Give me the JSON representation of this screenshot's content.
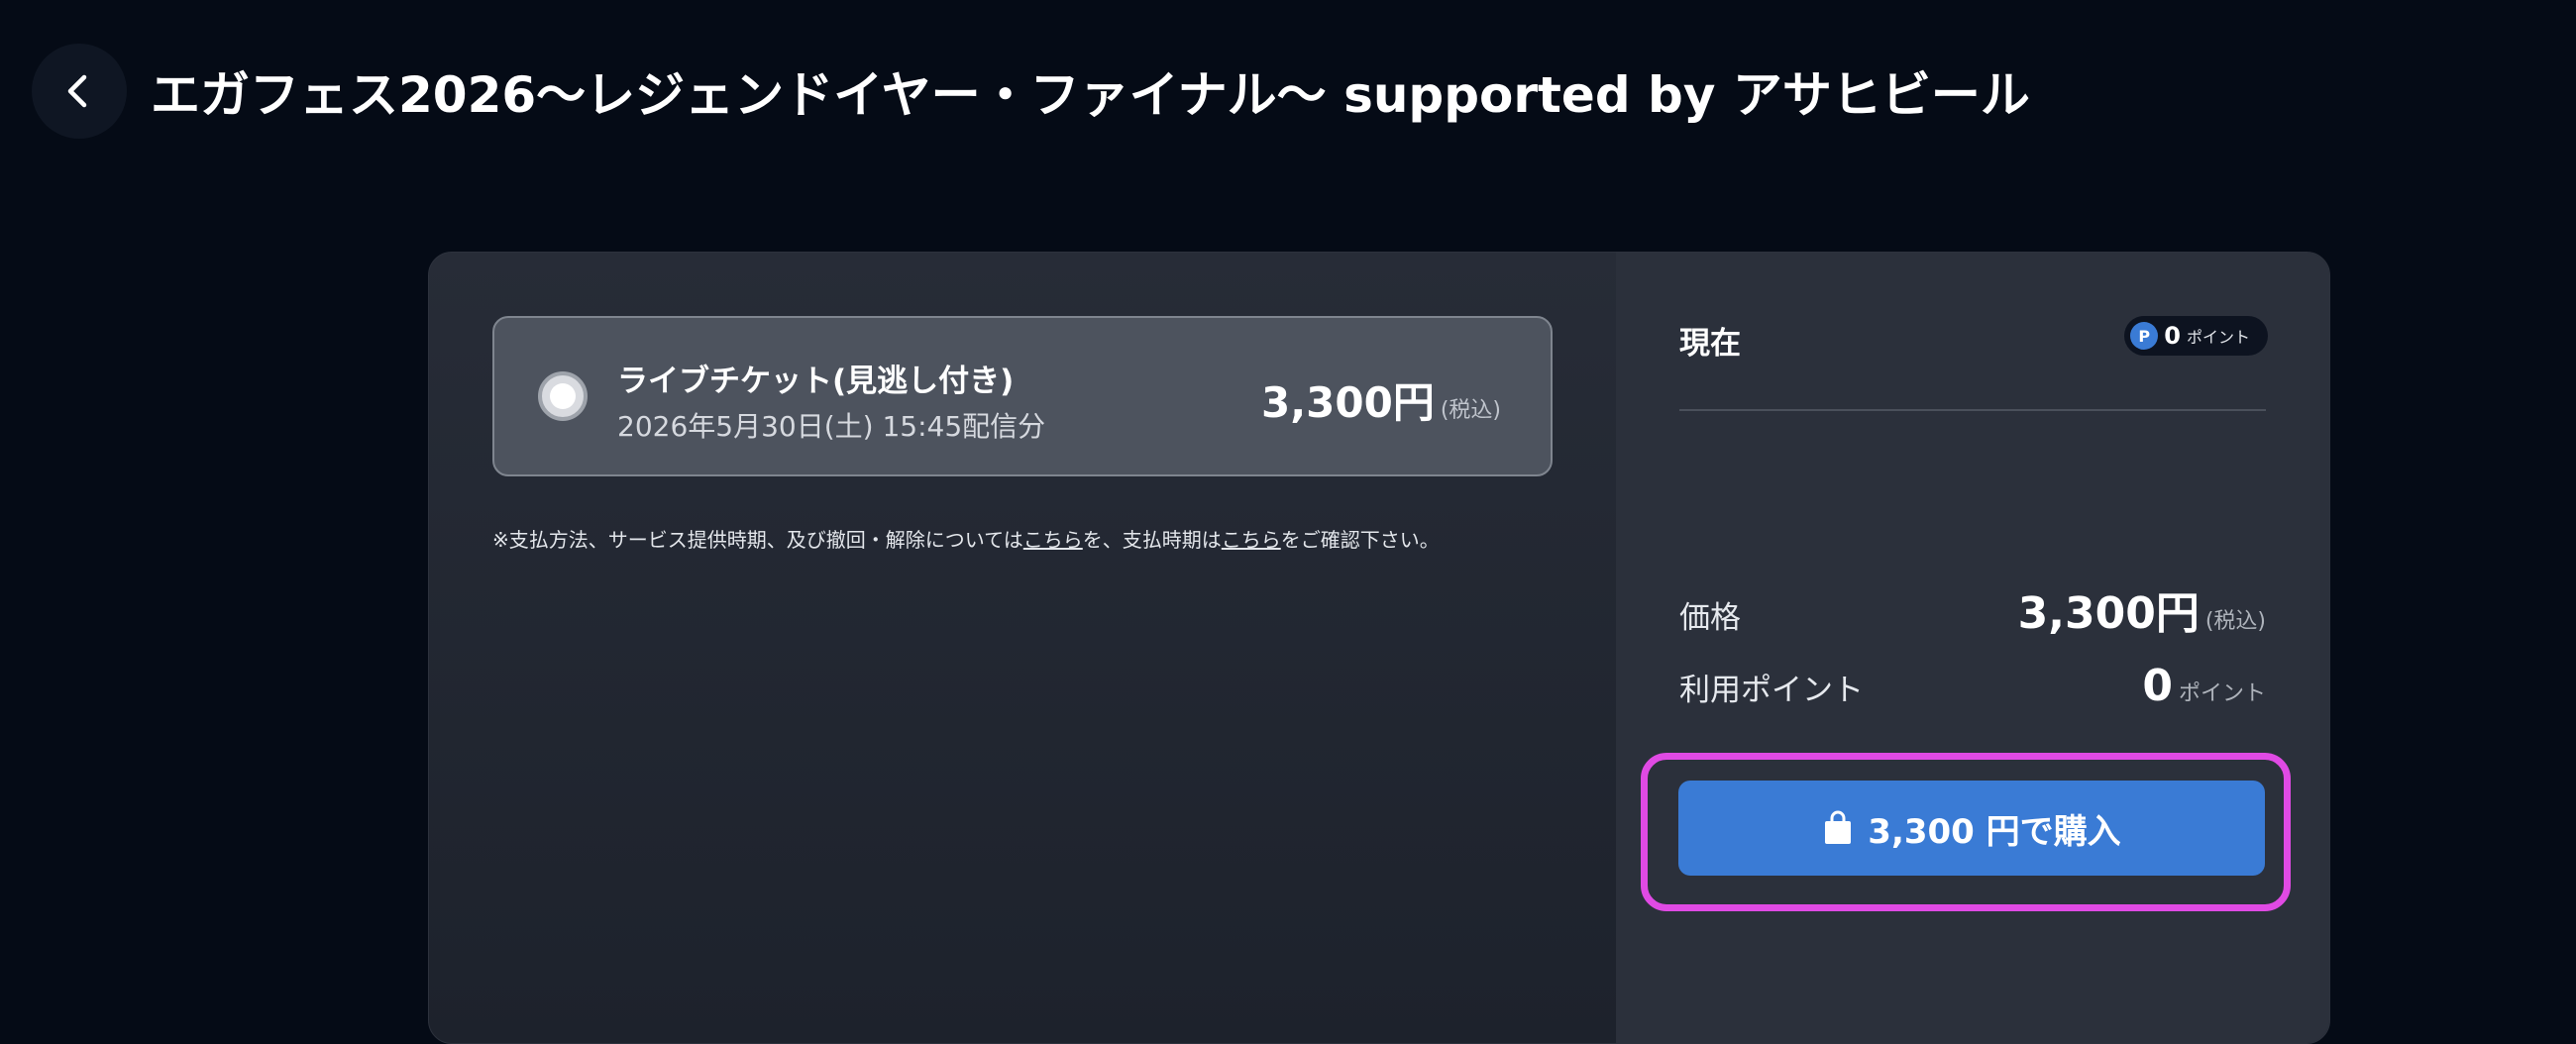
{
  "header": {
    "title": "エガフェス2026〜レジェンドイヤー・ファイナル〜 supported by アサヒビール",
    "back_icon": "chevron-left-icon"
  },
  "ticket": {
    "name": "ライブチケット(見逃し付き)",
    "date": "2026年5月30日(土) 15:45配信分",
    "price": "3,300円",
    "tax_note": "(税込)",
    "selected": true
  },
  "notice": {
    "part1": "※支払方法、サービス提供時期、及び撤回・解除については",
    "link1": "こちら",
    "part2": "を、支払時期は",
    "link2": "こちら",
    "part3": "をご確認下さい。"
  },
  "summary": {
    "current_label": "現在",
    "points_badge": "P",
    "points_value": "0",
    "points_unit": "ポイント",
    "price_label": "価格",
    "price_value": "3,300円",
    "price_tax": "(税込)",
    "use_points_label": "利用ポイント",
    "use_points_value": "0",
    "use_points_unit": "ポイント"
  },
  "buy_button": {
    "label": "3,300 円で購入",
    "icon": "shopping-bag-icon"
  },
  "colors": {
    "background": "#050b16",
    "accent_blue": "#3a7bd5",
    "highlight": "#e04ae4"
  }
}
